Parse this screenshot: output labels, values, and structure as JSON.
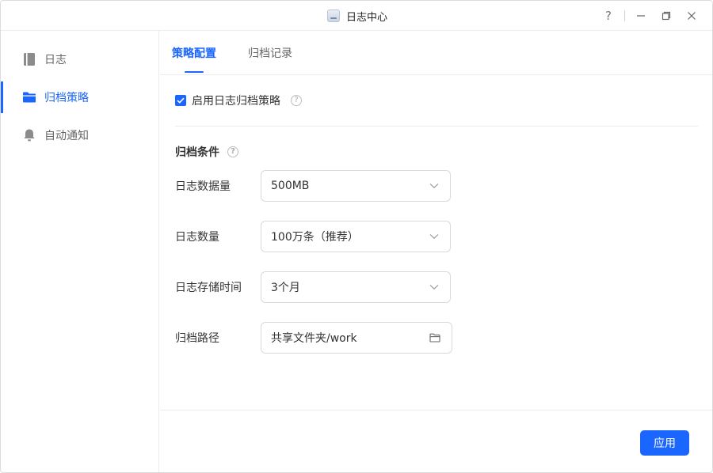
{
  "window": {
    "title": "日志中心",
    "controls": {
      "help": "?",
      "minimize": "minimize-icon",
      "restore": "restore-icon",
      "close": "close-icon"
    }
  },
  "sidebar": {
    "items": [
      {
        "label": "日志",
        "icon": "book-icon",
        "active": false
      },
      {
        "label": "归档策略",
        "icon": "folder-icon",
        "active": true
      },
      {
        "label": "自动通知",
        "icon": "bell-icon",
        "active": false
      }
    ]
  },
  "tabs": [
    {
      "label": "策略配置",
      "active": true
    },
    {
      "label": "归档记录",
      "active": false
    }
  ],
  "policy": {
    "enable_label": "启用日志归档策略",
    "enabled": true,
    "section_title": "归档条件",
    "fields": [
      {
        "label": "日志数据量",
        "value": "500MB",
        "type": "select"
      },
      {
        "label": "日志数量",
        "value": "100万条（推荐）",
        "type": "select"
      },
      {
        "label": "日志存储时间",
        "value": "3个月",
        "type": "select"
      },
      {
        "label": "归档路径",
        "value": "共享文件夹/work",
        "type": "path"
      }
    ]
  },
  "footer": {
    "apply_label": "应用"
  },
  "colors": {
    "accent": "#1a66ff",
    "border": "#ececec",
    "text": "#333333",
    "muted": "#666666"
  }
}
